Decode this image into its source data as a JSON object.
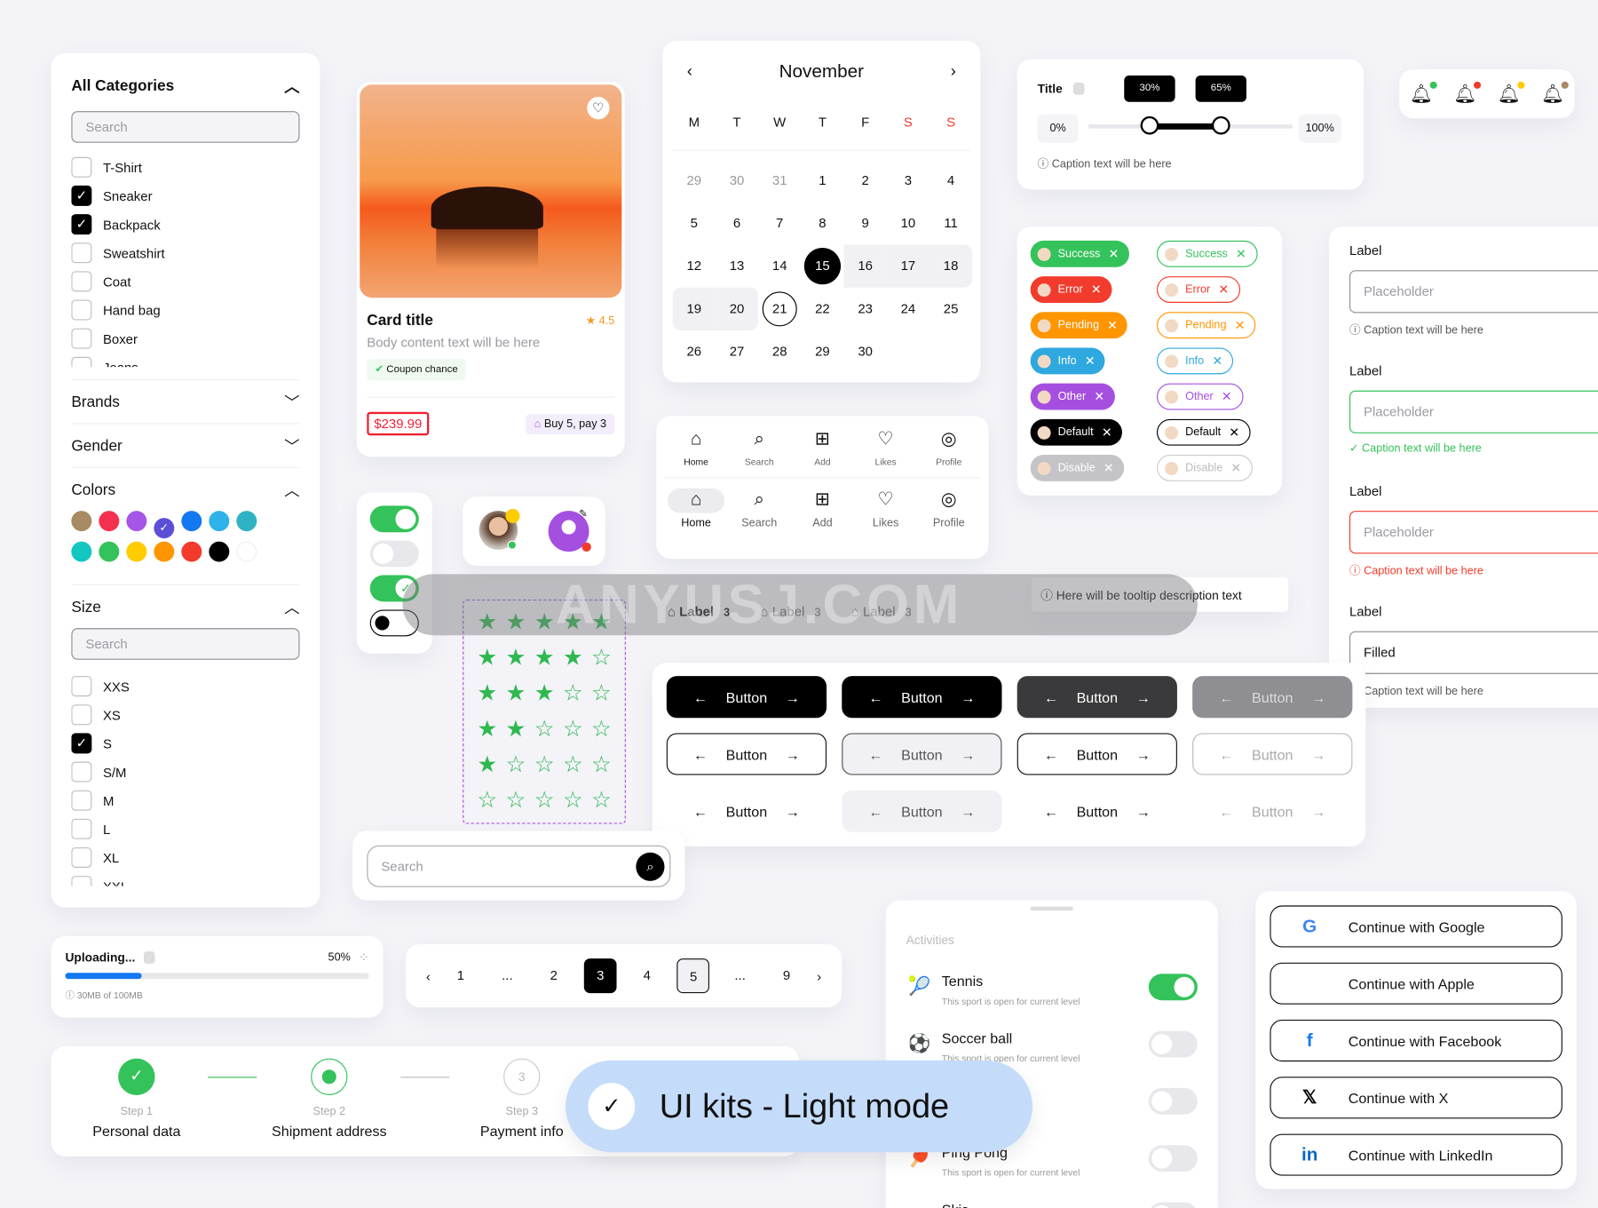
{
  "filters": {
    "title": "All Categories",
    "search_placeholder": "Search",
    "categories": [
      {
        "label": "T-Shirt",
        "checked": false
      },
      {
        "label": "Sneaker",
        "checked": true
      },
      {
        "label": "Backpack",
        "checked": true
      },
      {
        "label": "Sweatshirt",
        "checked": false
      },
      {
        "label": "Coat",
        "checked": false
      },
      {
        "label": "Hand bag",
        "checked": false
      },
      {
        "label": "Boxer",
        "checked": false
      },
      {
        "label": "Jeans",
        "checked": false
      }
    ],
    "brands": "Brands",
    "gender": "Gender",
    "colors_title": "Colors",
    "colors": [
      "#a88a63",
      "#f5314f",
      "#a556e6",
      "#5b4fd6",
      "#1478f2",
      "#2fb1ea",
      "#2eb3c4",
      "#14c6c0",
      "#34c25a",
      "#ffcc00",
      "#ff9500",
      "#f23b2c",
      "#000000",
      "#ffffff"
    ],
    "selected_color": "#5b4fd6",
    "size_title": "Size",
    "size_search_placeholder": "Search",
    "sizes": [
      {
        "label": "XXS",
        "checked": false
      },
      {
        "label": "XS",
        "checked": false
      },
      {
        "label": "S",
        "checked": true
      },
      {
        "label": "S/M",
        "checked": false
      },
      {
        "label": "M",
        "checked": false
      },
      {
        "label": "L",
        "checked": false
      },
      {
        "label": "XL",
        "checked": false
      },
      {
        "label": "XXL",
        "checked": false
      }
    ]
  },
  "product": {
    "title": "Card title",
    "rating": "4.5",
    "body": "Body content text will be here",
    "coupon": "Coupon chance",
    "price": "$239.99",
    "promo": "Buy 5, pay 3"
  },
  "calendar": {
    "month": "November",
    "weekdays": [
      "M",
      "T",
      "W",
      "T",
      "F",
      "S",
      "S"
    ],
    "days": [
      "29",
      "30",
      "31",
      "1",
      "2",
      "3",
      "4",
      "5",
      "6",
      "7",
      "8",
      "9",
      "10",
      "11",
      "12",
      "13",
      "14",
      "15",
      "16",
      "17",
      "18",
      "19",
      "20",
      "21",
      "22",
      "23",
      "24",
      "25",
      "26",
      "27",
      "28",
      "29",
      "30"
    ],
    "selected": "15",
    "today": "21"
  },
  "slider": {
    "title": "Title",
    "min_label": "0%",
    "max_label": "100%",
    "low": 30,
    "high": 65,
    "low_label": "30%",
    "high_label": "65%",
    "caption": "Caption text will be here"
  },
  "bells": {
    "dot_colors": [
      "#34c25a",
      "#f23b2c",
      "#ffcc00",
      "#a88a63"
    ]
  },
  "chips": {
    "filled": [
      {
        "label": "Success",
        "color": "#34c25a"
      },
      {
        "label": "Error",
        "color": "#f23b2c"
      },
      {
        "label": "Pending",
        "color": "#ff9500"
      },
      {
        "label": "Info",
        "color": "#2fa8e0"
      },
      {
        "label": "Other",
        "color": "#a54fe0"
      },
      {
        "label": "Default",
        "color": "#000000"
      },
      {
        "label": "Disable",
        "color": "#c4c4c8"
      }
    ]
  },
  "inputs": [
    {
      "label": "Label",
      "placeholder": "Placeholder",
      "caption": "Caption text will be here",
      "state": "default"
    },
    {
      "label": "Label",
      "placeholder": "Placeholder",
      "caption": "Caption text will be here",
      "state": "success"
    },
    {
      "label": "Label",
      "placeholder": "Placeholder",
      "caption": "Caption text will be here",
      "state": "error"
    },
    {
      "label": "Label",
      "value": "Filled",
      "caption": "Caption text will be here",
      "state": "filled"
    }
  ],
  "bottom_nav": {
    "items": [
      "Home",
      "Search",
      "Add",
      "Likes",
      "Profile"
    ],
    "active": "Home"
  },
  "tabs": {
    "items": [
      {
        "label": "Label",
        "count": "3"
      },
      {
        "label": "Label",
        "count": "3"
      },
      {
        "label": "Label",
        "count": "3"
      }
    ]
  },
  "tooltip": "Here will be tooltip description text",
  "watermark": "ANYUSJ.COM",
  "ratings": [
    5,
    4,
    3,
    2,
    1,
    0
  ],
  "buttons": {
    "label": "Button"
  },
  "search": {
    "placeholder": "Search"
  },
  "upload": {
    "title": "Uploading...",
    "percent": "50%",
    "progress_fill": 25,
    "caption": "30MB of 100MB"
  },
  "pagination": {
    "pages": [
      "1",
      "...",
      "2",
      "3",
      "4",
      "5",
      "...",
      "9"
    ],
    "current": "3",
    "hovered": "5"
  },
  "stepper": [
    {
      "step": "Step 1",
      "title": "Personal data",
      "state": "done"
    },
    {
      "step": "Step 2",
      "title": "Shipment address",
      "state": "active"
    },
    {
      "step": "Step 3",
      "num": "3",
      "title": "Payment info",
      "state": "todo"
    }
  ],
  "badge": "UI kits - Light mode",
  "activities": {
    "title": "Activities",
    "items": [
      {
        "name": "Tennis",
        "icon": "🎾",
        "desc": "This sport is open for current level",
        "on": true
      },
      {
        "name": "Soccer ball",
        "icon": "⚽",
        "desc": "This sport is open for current level",
        "on": false
      },
      {
        "name": "",
        "icon": "",
        "desc": "current level",
        "on": false
      },
      {
        "name": "Ping Pong",
        "icon": "🏓",
        "desc": "This sport is open for current level",
        "on": false
      },
      {
        "name": "Skis",
        "icon": "",
        "desc": "",
        "on": false
      }
    ]
  },
  "social": [
    {
      "label": "Continue with Google",
      "icon": "G",
      "color": "#4285f4"
    },
    {
      "label": "Continue with Apple",
      "icon": "",
      "color": "#000"
    },
    {
      "label": "Continue with Facebook",
      "icon": "f",
      "color": "#1877f2"
    },
    {
      "label": "Continue with X",
      "icon": "𝕏",
      "color": "#000"
    },
    {
      "label": "Continue with LinkedIn",
      "icon": "in",
      "color": "#0a66c2"
    }
  ]
}
